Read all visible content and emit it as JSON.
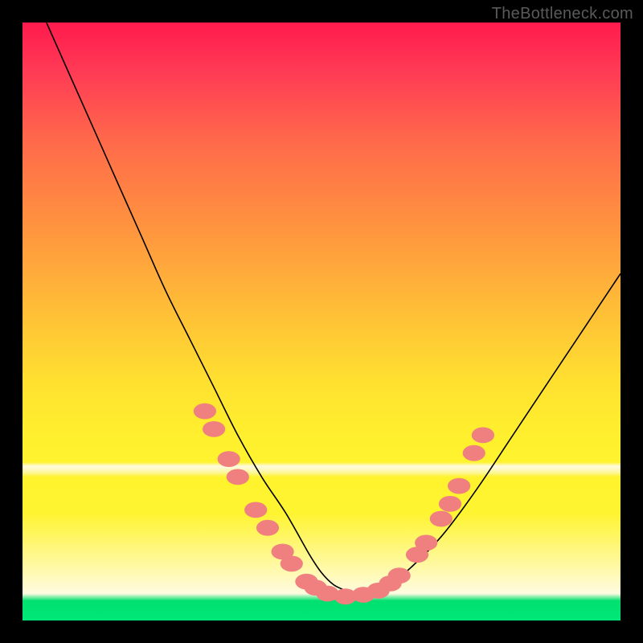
{
  "watermark": "TheBottleneck.com",
  "colors": {
    "gradient_top": "#ff1a4d",
    "gradient_mid": "#ffe030",
    "gradient_band": "#fffbe0",
    "gradient_bottom": "#00e878",
    "curve": "#000000",
    "bead": "#f08080",
    "frame": "#000000"
  },
  "chart_data": {
    "type": "line",
    "title": "",
    "xlabel": "",
    "ylabel": "",
    "xlim": [
      0,
      100
    ],
    "ylim": [
      0,
      100
    ],
    "grid": false,
    "legend": false,
    "series": [
      {
        "name": "bottleneck-curve",
        "x": [
          4,
          8,
          12,
          16,
          20,
          24,
          28,
          32,
          36,
          40,
          44,
          48,
          50,
          52,
          54,
          56,
          58,
          60,
          64,
          70,
          76,
          82,
          88,
          94,
          100
        ],
        "y": [
          100,
          91,
          82,
          73,
          64,
          55,
          47,
          39,
          31,
          24,
          18,
          11,
          8,
          6,
          5,
          4,
          4,
          5,
          8,
          14,
          22,
          31,
          40,
          49,
          58
        ]
      }
    ],
    "annotations": {
      "beads": [
        {
          "x": 30.5,
          "y": 35
        },
        {
          "x": 32.0,
          "y": 32
        },
        {
          "x": 34.5,
          "y": 27
        },
        {
          "x": 36.0,
          "y": 24
        },
        {
          "x": 39.0,
          "y": 18.5
        },
        {
          "x": 41.0,
          "y": 15.5
        },
        {
          "x": 43.5,
          "y": 11.5
        },
        {
          "x": 45.0,
          "y": 9.5
        },
        {
          "x": 47.5,
          "y": 6.5
        },
        {
          "x": 49.0,
          "y": 5.5
        },
        {
          "x": 51.0,
          "y": 4.5
        },
        {
          "x": 54.0,
          "y": 4.0
        },
        {
          "x": 57.0,
          "y": 4.3
        },
        {
          "x": 59.5,
          "y": 5.0
        },
        {
          "x": 61.5,
          "y": 6.2
        },
        {
          "x": 63.0,
          "y": 7.5
        },
        {
          "x": 66.0,
          "y": 11.0
        },
        {
          "x": 67.5,
          "y": 13.0
        },
        {
          "x": 70.0,
          "y": 17.0
        },
        {
          "x": 71.5,
          "y": 19.5
        },
        {
          "x": 73.0,
          "y": 22.5
        },
        {
          "x": 75.5,
          "y": 28.0
        },
        {
          "x": 77.0,
          "y": 31.0
        }
      ],
      "bead_r": 1.4
    }
  }
}
